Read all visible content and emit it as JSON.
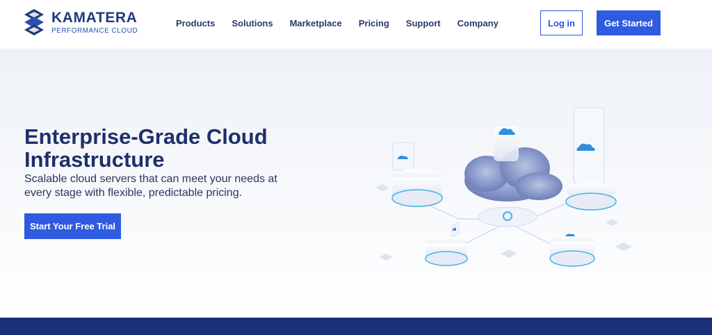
{
  "brand": {
    "name": "KAMATERA",
    "tagline": "PERFORMANCE CLOUD",
    "color": "#1f3a7a"
  },
  "nav": {
    "items": [
      {
        "label": "Products"
      },
      {
        "label": "Solutions"
      },
      {
        "label": "Marketplace"
      },
      {
        "label": "Pricing"
      },
      {
        "label": "Support"
      },
      {
        "label": "Company"
      }
    ]
  },
  "header": {
    "login_label": "Log in",
    "get_started_label": "Get Started"
  },
  "hero": {
    "title": "Enterprise-Grade Cloud Infrastructure",
    "subtitle": "Scalable cloud servers that can meet your needs at every stage with flexible, predictable pricing.",
    "cta_label": "Start Your Free Trial",
    "illustration_icon": "cloud-network-illustration"
  },
  "colors": {
    "accent": "#2e5be0",
    "footer": "#1a2f7a"
  }
}
